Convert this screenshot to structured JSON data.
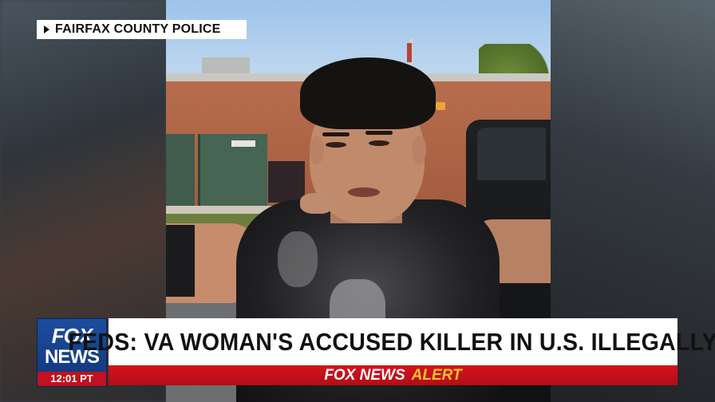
{
  "source_tag": {
    "label": "FAIRFAX COUNTY POLICE"
  },
  "logo": {
    "line1": "FOX",
    "line2": "NEWS",
    "time": "12:01 PT"
  },
  "headline": {
    "text": "FEDS: VA WOMAN'S ACCUSED KILLER IN U.S. ILLEGALLY"
  },
  "alert_bar": {
    "brand": "FOX NEWS",
    "word": "ALERT"
  },
  "colors": {
    "alert_red": "#c1121f",
    "alert_yellow": "#f7c52b",
    "logo_blue": "#1d4d9e"
  }
}
